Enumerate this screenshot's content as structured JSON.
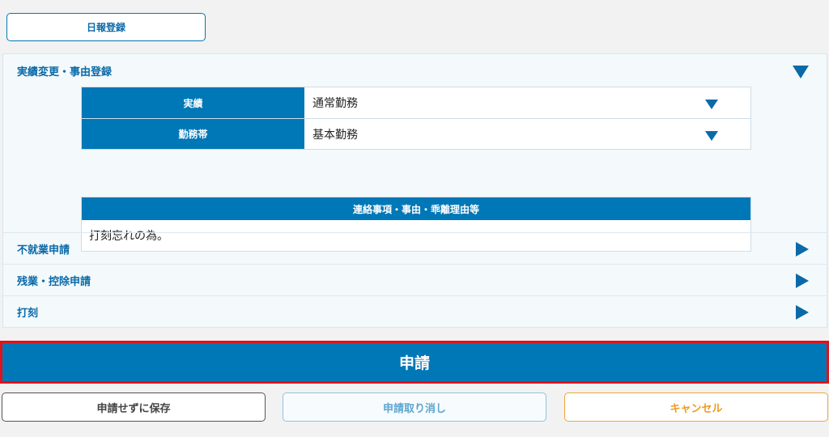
{
  "top_button": {
    "label": "日報登録"
  },
  "sections": {
    "actual": {
      "title": "実績変更・事由登録",
      "rows": [
        {
          "label": "実績",
          "value": "通常勤務"
        },
        {
          "label": "勤務帯",
          "value": "基本勤務"
        }
      ],
      "notes": {
        "header": "連絡事項・事由・乖離理由等",
        "value": "打刻忘れの為。"
      }
    },
    "non_work": {
      "title": "不就業申請"
    },
    "overtime": {
      "title": "残業・控除申請"
    },
    "stamp": {
      "title": "打刻"
    }
  },
  "submit": {
    "label": "申請"
  },
  "bottom": {
    "save_label": "申請せずに保存",
    "withdraw_label": "申請取り消し",
    "cancel_label": "キャンセル"
  },
  "colors": {
    "primary": "#0077b6",
    "highlight_border": "#e0121c",
    "cancel_accent": "#ee9a20"
  }
}
